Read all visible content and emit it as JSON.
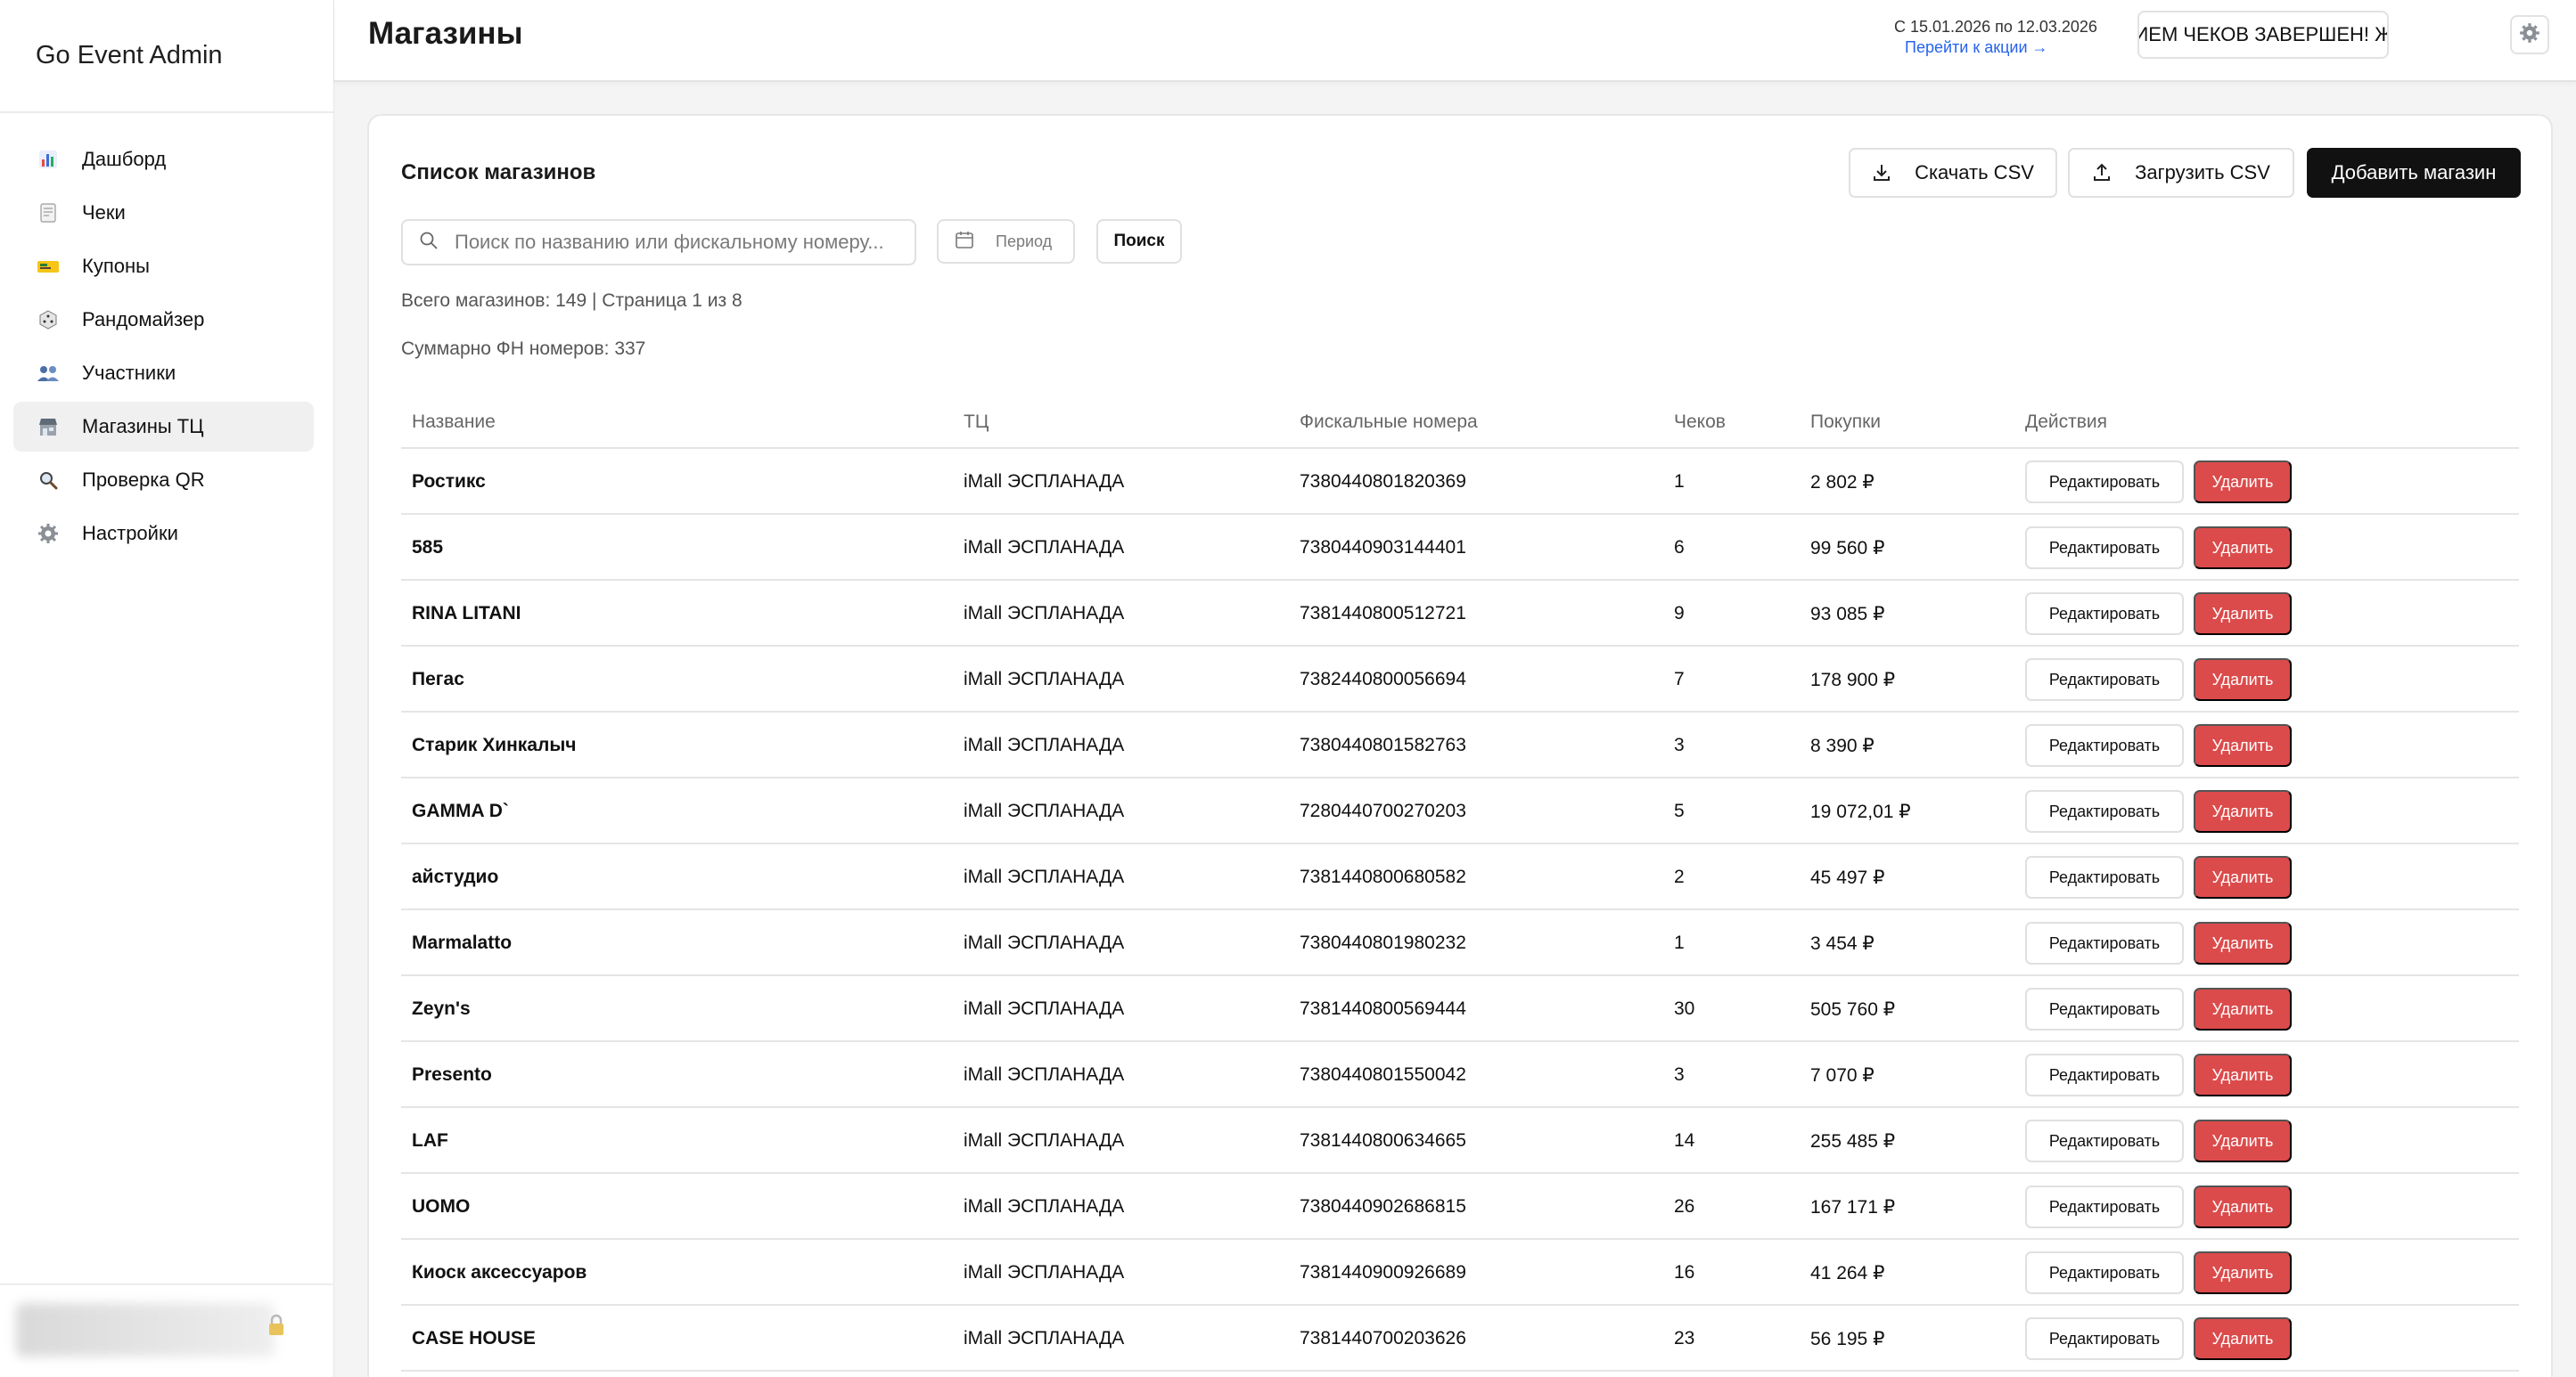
{
  "app": {
    "brand": "Go Event Admin"
  },
  "sidebar": {
    "items": [
      {
        "label": "Дашборд",
        "icon": "bar-chart-icon",
        "active": false
      },
      {
        "label": "Чеки",
        "icon": "receipt-icon",
        "active": false
      },
      {
        "label": "Купоны",
        "icon": "ticket-icon",
        "active": false
      },
      {
        "label": "Рандомайзер",
        "icon": "dice-icon",
        "active": false
      },
      {
        "label": "Участники",
        "icon": "users-icon",
        "active": false
      },
      {
        "label": "Магазины ТЦ",
        "icon": "store-icon",
        "active": true
      },
      {
        "label": "Проверка QR",
        "icon": "magnifier-icon",
        "active": false
      },
      {
        "label": "Настройки",
        "icon": "gear-icon",
        "active": false
      }
    ]
  },
  "header": {
    "title": "Магазины",
    "promo_dates": "С 15.01.2026 по 12.03.2026",
    "promo_link": "Перейти к акции →",
    "status_button": "ПРИЕМ ЧЕКОВ ЗАВЕРШЕН! ЖДЕ"
  },
  "main": {
    "title": "Список магазинов",
    "download_csv": "Скачать CSV",
    "upload_csv": "Загрузить CSV",
    "add_store": "Добавить магазин",
    "search_placeholder": "Поиск по названию или фискальному номеру...",
    "period_label": "Период",
    "search_button": "Поиск",
    "total_line": "Всего магазинов: 149 | Страница 1 из 8",
    "fn_total_line": "Суммарно ФН номеров: 337"
  },
  "table": {
    "columns": [
      "Название",
      "ТЦ",
      "Фискальные номера",
      "Чеков",
      "Покупки",
      "Действия"
    ],
    "edit_label": "Редактировать",
    "delete_label": "Удалить",
    "rows": [
      {
        "name": "Ростикс",
        "mall": "iMall ЭСПЛАНАДА",
        "fn": "7380440801820369",
        "count": "1",
        "sum": "2 802 ₽"
      },
      {
        "name": "585",
        "mall": "iMall ЭСПЛАНАДА",
        "fn": "7380440903144401",
        "count": "6",
        "sum": "99 560 ₽"
      },
      {
        "name": "RINA LITANI",
        "mall": "iMall ЭСПЛАНАДА",
        "fn": "7381440800512721",
        "count": "9",
        "sum": "93 085 ₽"
      },
      {
        "name": "Пегас",
        "mall": "iMall ЭСПЛАНАДА",
        "fn": "7382440800056694",
        "count": "7",
        "sum": "178 900 ₽"
      },
      {
        "name": "Старик Хинкалыч",
        "mall": "iMall ЭСПЛАНАДА",
        "fn": "7380440801582763",
        "count": "3",
        "sum": "8 390 ₽"
      },
      {
        "name": "GAMMA D`",
        "mall": "iMall ЭСПЛАНАДА",
        "fn": "7280440700270203",
        "count": "5",
        "sum": "19 072,01 ₽"
      },
      {
        "name": "айстудио",
        "mall": "iMall ЭСПЛАНАДА",
        "fn": "7381440800680582",
        "count": "2",
        "sum": "45 497 ₽"
      },
      {
        "name": "Marmalatto",
        "mall": "iMall ЭСПЛАНАДА",
        "fn": "7380440801980232",
        "count": "1",
        "sum": "3 454 ₽"
      },
      {
        "name": "Zeyn's",
        "mall": "iMall ЭСПЛАНАДА",
        "fn": "7381440800569444",
        "count": "30",
        "sum": "505 760 ₽"
      },
      {
        "name": "Presento",
        "mall": "iMall ЭСПЛАНАДА",
        "fn": "7380440801550042",
        "count": "3",
        "sum": "7 070 ₽"
      },
      {
        "name": "LAF",
        "mall": "iMall ЭСПЛАНАДА",
        "fn": "7381440800634665",
        "count": "14",
        "sum": "255 485 ₽"
      },
      {
        "name": "UOMO",
        "mall": "iMall ЭСПЛАНАДА",
        "fn": "7380440902686815",
        "count": "26",
        "sum": "167 171 ₽"
      },
      {
        "name": "Киоск аксессуаров",
        "mall": "iMall ЭСПЛАНАДА",
        "fn": "7381440900926689",
        "count": "16",
        "sum": "41 264 ₽"
      },
      {
        "name": "CASE HOUSE",
        "mall": "iMall ЭСПЛАНАДА",
        "fn": "7381440700203626",
        "count": "23",
        "sum": "56 195 ₽"
      }
    ]
  },
  "colors": {
    "primary_dark": "#111111",
    "danger": "#dc4b4b",
    "link": "#2563eb",
    "active_nav_bg": "#f0f0f1"
  }
}
